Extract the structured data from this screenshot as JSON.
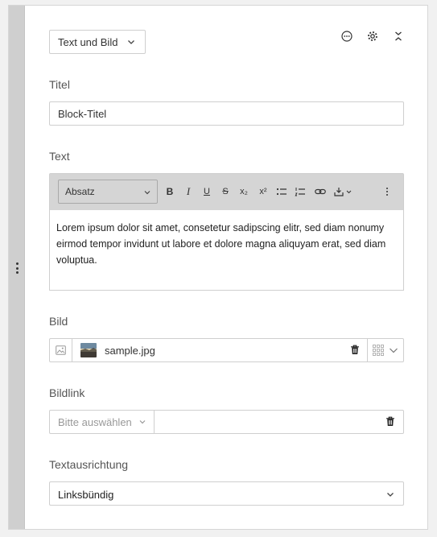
{
  "block_type": {
    "selected": "Text und Bild"
  },
  "header_actions": [
    "more-icon",
    "gear-icon",
    "collapse-icon"
  ],
  "title_field": {
    "label": "Titel",
    "value": "Block-Titel"
  },
  "text_field": {
    "label": "Text",
    "paragraph_format": "Absatz",
    "toolbar": [
      "B",
      "I",
      "U",
      "S",
      "x₂",
      "x²"
    ],
    "content": "Lorem ipsum dolor sit amet, consetetur sadipscing elitr, sed diam nonumy eirmod tempor invidunt ut labore et dolore magna aliquyam erat, sed diam voluptua."
  },
  "image_field": {
    "label": "Bild",
    "filename": "sample.jpg"
  },
  "image_link_field": {
    "label": "Bildlink",
    "placeholder": "Bitte auswählen"
  },
  "alignment_field": {
    "label": "Textausrichtung",
    "selected": "Linksbündig"
  }
}
